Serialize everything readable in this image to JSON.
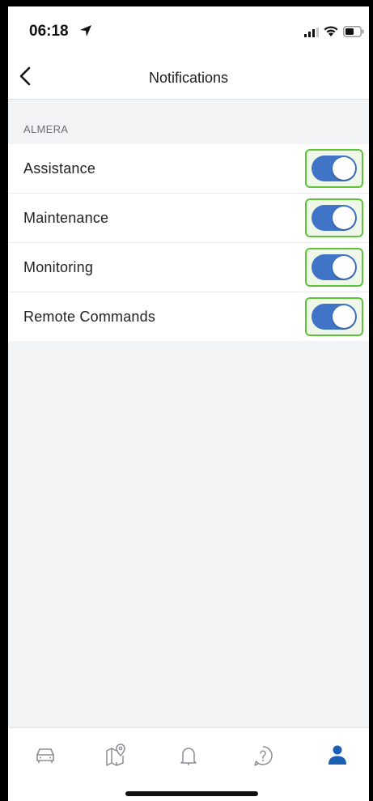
{
  "status_bar": {
    "time": "06:18"
  },
  "nav": {
    "title": "Notifications",
    "back_icon": "chevron-left-icon"
  },
  "section": {
    "header": "ALMERA"
  },
  "settings": [
    {
      "label": "Assistance",
      "enabled": true
    },
    {
      "label": "Maintenance",
      "enabled": true
    },
    {
      "label": "Monitoring",
      "enabled": true
    },
    {
      "label": "Remote Commands",
      "enabled": true
    }
  ],
  "tab_bar": {
    "tabs": [
      {
        "icon": "car-icon",
        "active": false
      },
      {
        "icon": "map-pin-icon",
        "active": false
      },
      {
        "icon": "bell-icon",
        "active": false
      },
      {
        "icon": "help-icon",
        "active": false
      },
      {
        "icon": "profile-icon",
        "active": true
      }
    ],
    "active_color": "#1a5fb4",
    "inactive_color": "#8a8d93"
  },
  "colors": {
    "toggle_on": "#3f74c7",
    "highlight": "#5dc43a",
    "background": "#f2f3f5"
  }
}
